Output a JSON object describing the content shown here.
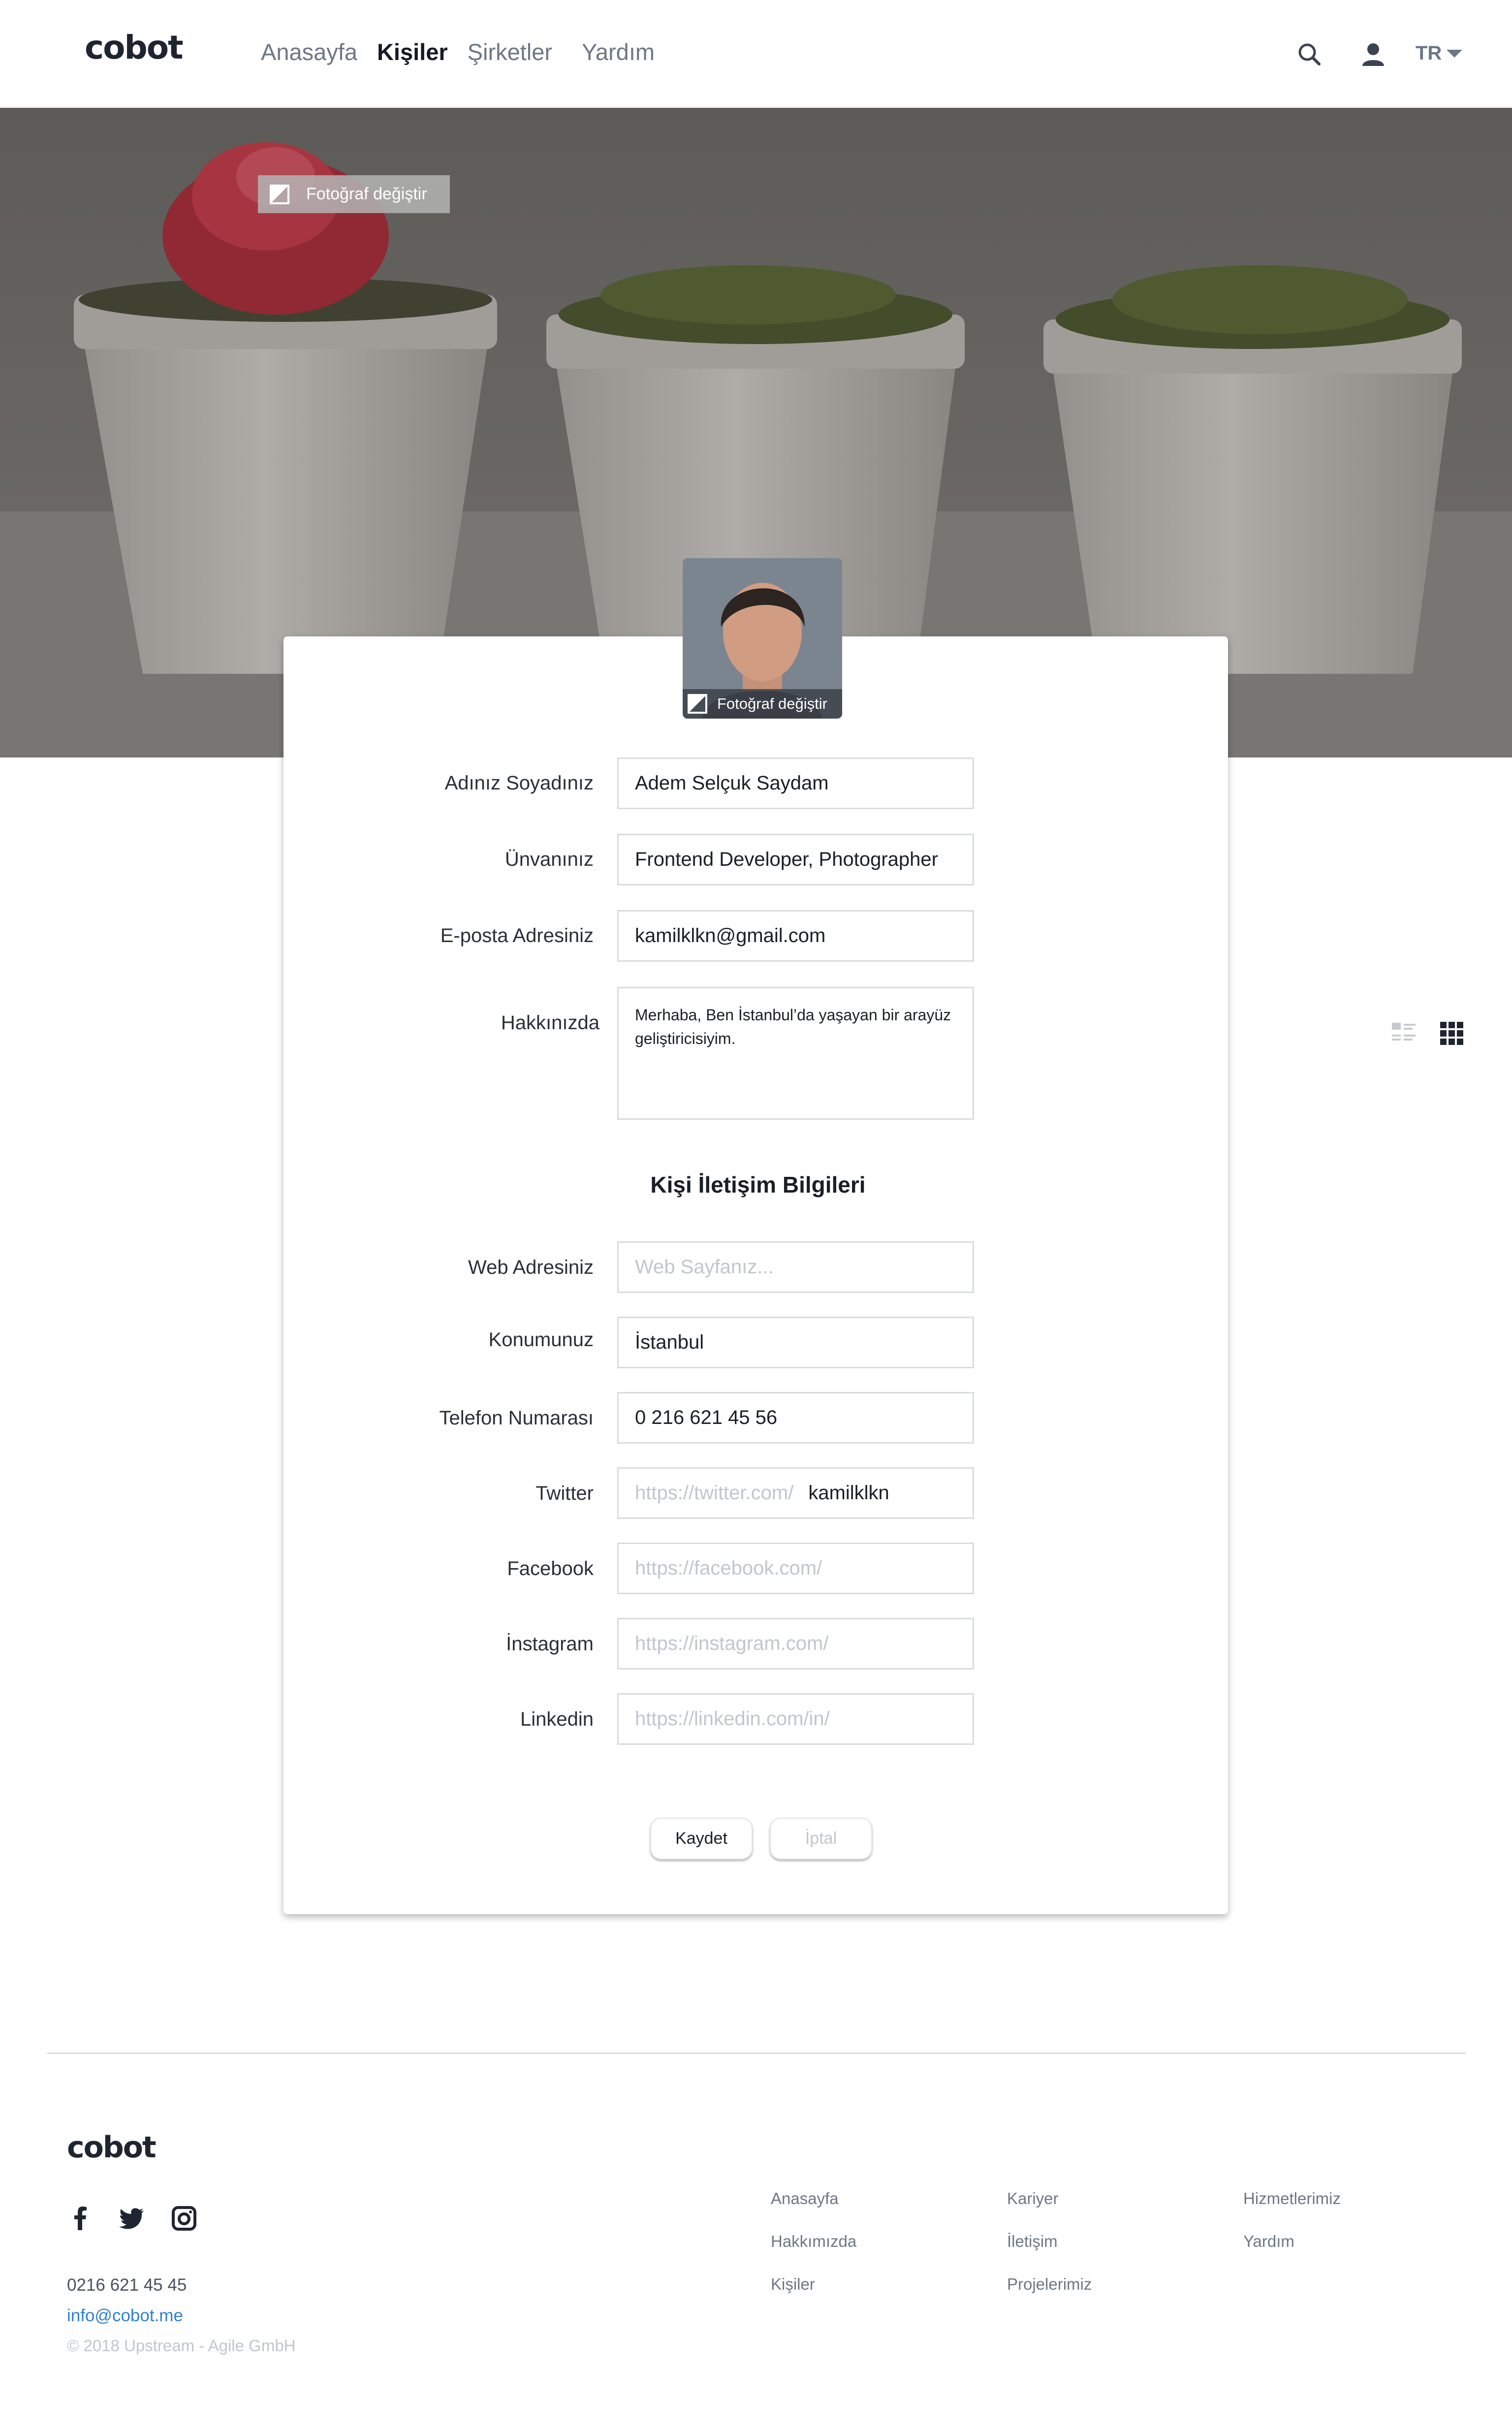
{
  "header": {
    "logo": "cobot",
    "nav": [
      "Anasayfa",
      "Kişiler",
      "Şirketler",
      "Yardım"
    ],
    "language": "TR",
    "icons": [
      "search-icon",
      "user-icon",
      "chevron-down-icon"
    ]
  },
  "hero": {
    "change_photo_label": "Fotoğraf değiştir"
  },
  "profile": {
    "change_photo_label": "Fotoğraf değiştir",
    "fields": {
      "name_label": "Adınız Soyadınız",
      "name_value": "Adem Selçuk Saydam",
      "title_label": "Ünvanınız",
      "title_value": "Frontend Developer, Photographer",
      "email_label": "E-posta Adresiniz",
      "email_value": "kamilklkn@gmail.com",
      "about_label": "Hakkınızda",
      "about_value": "Merhaba, Ben İstanbul’da yaşayan bir arayüz geliştiricisiyim."
    },
    "contact_title": "Kişi İletişim Bilgileri",
    "contact": {
      "web_label": "Web Adresiniz",
      "web_placeholder": "Web Sayfanız...",
      "location_label": "Konumunuz",
      "location_value": "İstanbul",
      "phone_label": "Telefon Numarası",
      "phone_value": "0 216 621 45 56",
      "twitter_label": "Twitter",
      "twitter_prefix": "https://twitter.com/",
      "twitter_value": "kamilklkn",
      "facebook_label": "Facebook",
      "facebook_placeholder": "https://facebook.com/",
      "instagram_label": "İnstagram",
      "instagram_placeholder": "https://instagram.com/",
      "linkedin_label": "Linkedin",
      "linkedin_placeholder": "https://linkedin.com/in/"
    },
    "save_label": "Kaydet",
    "cancel_label": "İptal"
  },
  "footer": {
    "logo": "cobot",
    "phone": "0216 621 45 45",
    "email": "info@cobot.me",
    "copyright": "© 2018 Upstream - Agile GmbH",
    "links": {
      "col1": [
        "Anasayfa",
        "Hakkımızda",
        "Kişiler"
      ],
      "col2": [
        "Kariyer",
        "İletişim",
        "Projelerimiz"
      ],
      "col3": [
        "Hizmetlerimiz",
        "Yardım"
      ]
    }
  },
  "colors": {
    "accent_link": "#2f7fd1",
    "text_dark": "#1a1f27",
    "text_muted": "#6d7785",
    "placeholder": "#c2c6cb"
  }
}
